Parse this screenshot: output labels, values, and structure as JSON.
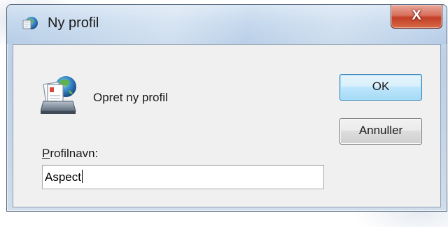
{
  "window": {
    "title": "Ny profil",
    "close_glyph": "X"
  },
  "dialog": {
    "heading": "Opret ny profil",
    "field_label_access_key": "P",
    "field_label_rest": "rofilnavn:",
    "field_value": "Aspect"
  },
  "buttons": {
    "ok_label": "OK",
    "cancel_label": "Annuller"
  },
  "icons": {
    "title": "mail-globe-icon",
    "profile": "mail-profile-icon"
  },
  "colors": {
    "titlebar": "#c2d6ec",
    "close_button": "#c33e26",
    "client_bg": "#f0f0f0",
    "ok_border": "#3c7fb1"
  }
}
